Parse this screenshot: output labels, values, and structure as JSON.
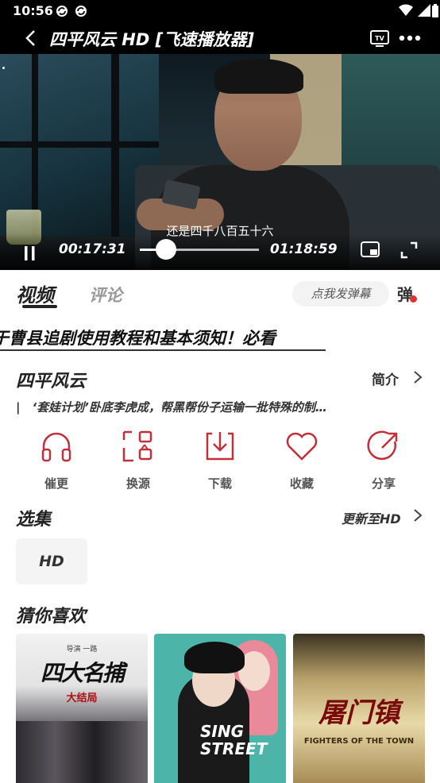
{
  "status_bar": {
    "time": "10:56"
  },
  "header": {
    "title": "四平风云 HD [飞速播放器]"
  },
  "player": {
    "subtitle": "还是四千八百五十六",
    "current_time": "00:17:31",
    "duration": "01:18:59",
    "progress": 0.222
  },
  "tabs": {
    "video": "视频",
    "comments": "评论"
  },
  "danmaku": {
    "input_placeholder": "点我发弹幕",
    "toggle_label": "弹"
  },
  "notice": {
    "text": "于曹县追剧使用教程和基本须知！必看"
  },
  "show": {
    "title": "四平风云",
    "intro_label": "简介",
    "description": "|　‘套娃计划’卧底李虎成，帮黑帮份子运输一批特殊的制…"
  },
  "actions": [
    {
      "label": "催更",
      "icon": "headphones-icon"
    },
    {
      "label": "换源",
      "icon": "switch-source-icon"
    },
    {
      "label": "下载",
      "icon": "download-icon"
    },
    {
      "label": "收藏",
      "icon": "heart-icon"
    },
    {
      "label": "分享",
      "icon": "share-icon"
    }
  ],
  "episodes": {
    "heading": "选集",
    "update_status": "更新至HD",
    "items": [
      "HD"
    ]
  },
  "recommend": {
    "heading": "猜你喜欢",
    "posters": [
      {
        "line1": "导演 一路",
        "title": "四大名捕",
        "subtitle": "大结局"
      },
      {
        "title_line1": "SING",
        "title_line2": "STREET"
      },
      {
        "title": "屠门镇",
        "subtitle": "FIGHTERS OF THE TOWN"
      }
    ]
  },
  "colors": {
    "accent": "#c0303a",
    "dark": "#000000"
  }
}
